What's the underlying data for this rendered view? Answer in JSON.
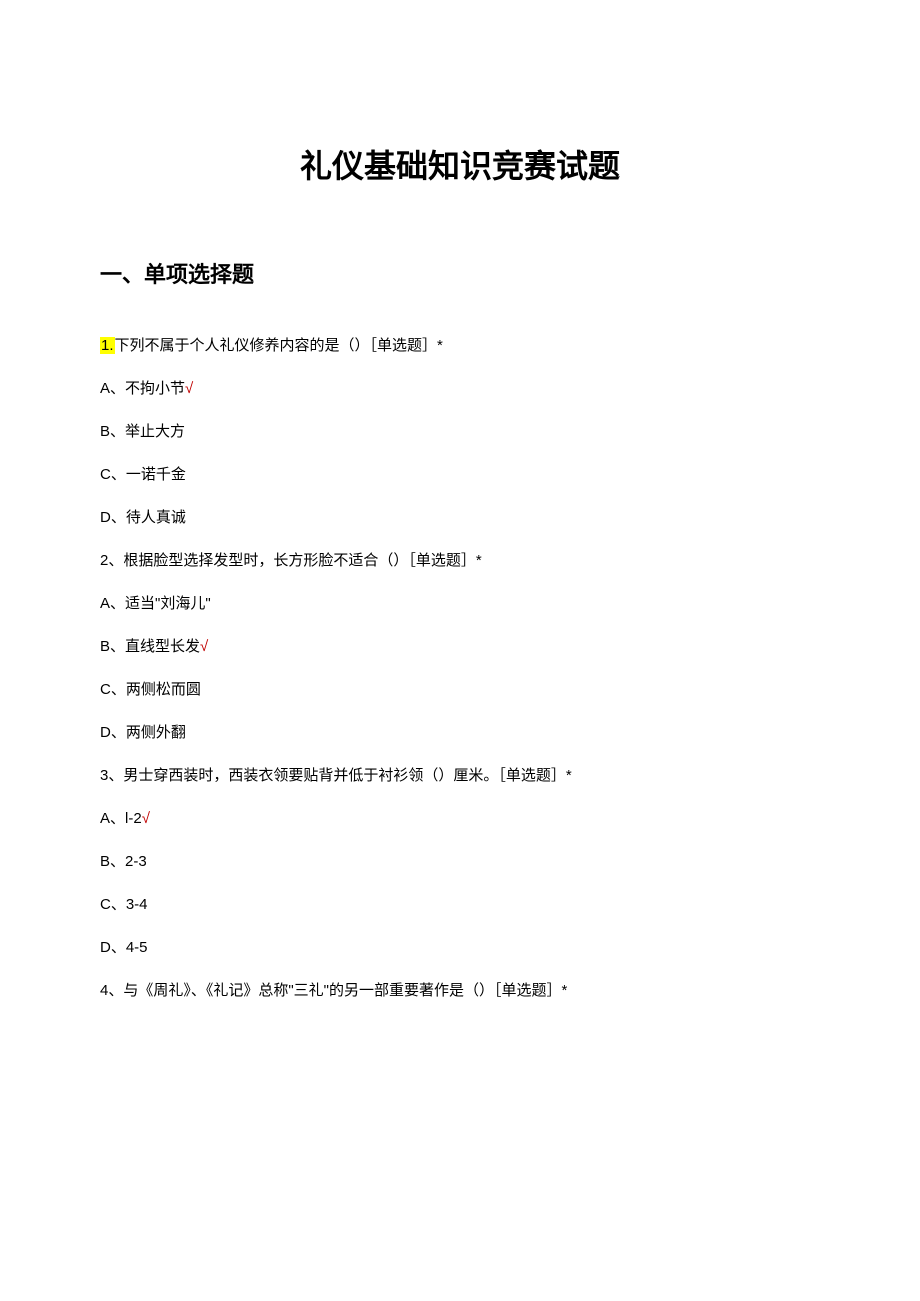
{
  "title": "礼仪基础知识竞赛试题",
  "section_heading": "一、单项选择题",
  "questions": [
    {
      "number_highlighted": "1.",
      "text": "下列不属于个人礼仪修养内容的是（）［单选题］*",
      "options": [
        {
          "label": "A、不拘小节",
          "correct": true
        },
        {
          "label": "B、举止大方",
          "correct": false
        },
        {
          "label": "C、一诺千金",
          "correct": false
        },
        {
          "label": "D、待人真诚",
          "correct": false
        }
      ]
    },
    {
      "number": "2、",
      "text": "根据脸型选择发型时，长方形脸不适合（）［单选题］*",
      "options": [
        {
          "label": "A、适当\"刘海儿\"",
          "correct": false
        },
        {
          "label": "B、直线型长发",
          "correct": true
        },
        {
          "label": "C、两侧松而圆",
          "correct": false
        },
        {
          "label": "D、两侧外翻",
          "correct": false
        }
      ]
    },
    {
      "number": "3、",
      "text": "男士穿西装时，西装衣领要贴背并低于衬衫领（）厘米。［单选题］*",
      "options": [
        {
          "label": "A、l-2",
          "correct": true
        },
        {
          "label": "B、2-3",
          "correct": false
        },
        {
          "label": "C、3-4",
          "correct": false
        },
        {
          "label": "D、4-5",
          "correct": false
        }
      ]
    },
    {
      "number": "4、",
      "text": "与《周礼》、《礼记》总称\"三礼\"的另一部重要著作是（）［单选题］*",
      "options": []
    }
  ],
  "check_symbol": "√"
}
